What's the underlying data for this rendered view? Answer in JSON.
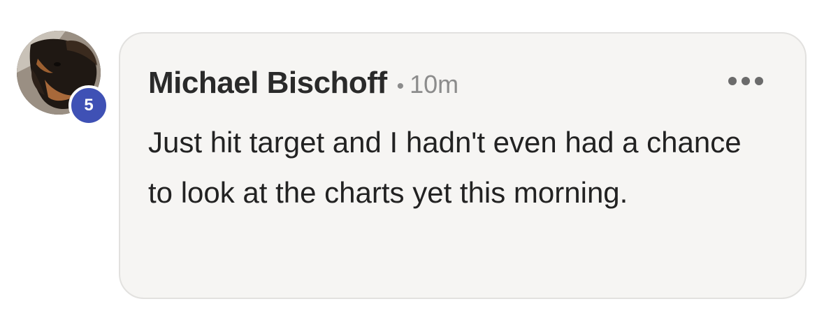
{
  "comment": {
    "avatar": {
      "alt": "dachshund-photo",
      "badge_count": "5",
      "badge_color": "#3f51b5"
    },
    "author": "Michael Bischoff",
    "separator": "•",
    "time_ago": "10m",
    "more_icon": "more-horizontal-icon",
    "text": "Just hit target and I hadn't even had a chance to look at the charts yet this morning."
  },
  "colors": {
    "bubble_bg": "#f6f5f3",
    "bubble_border": "#e2e1df",
    "author_text": "#2a2a2a",
    "meta_text": "#8c8c8c",
    "body_text": "#222222"
  }
}
